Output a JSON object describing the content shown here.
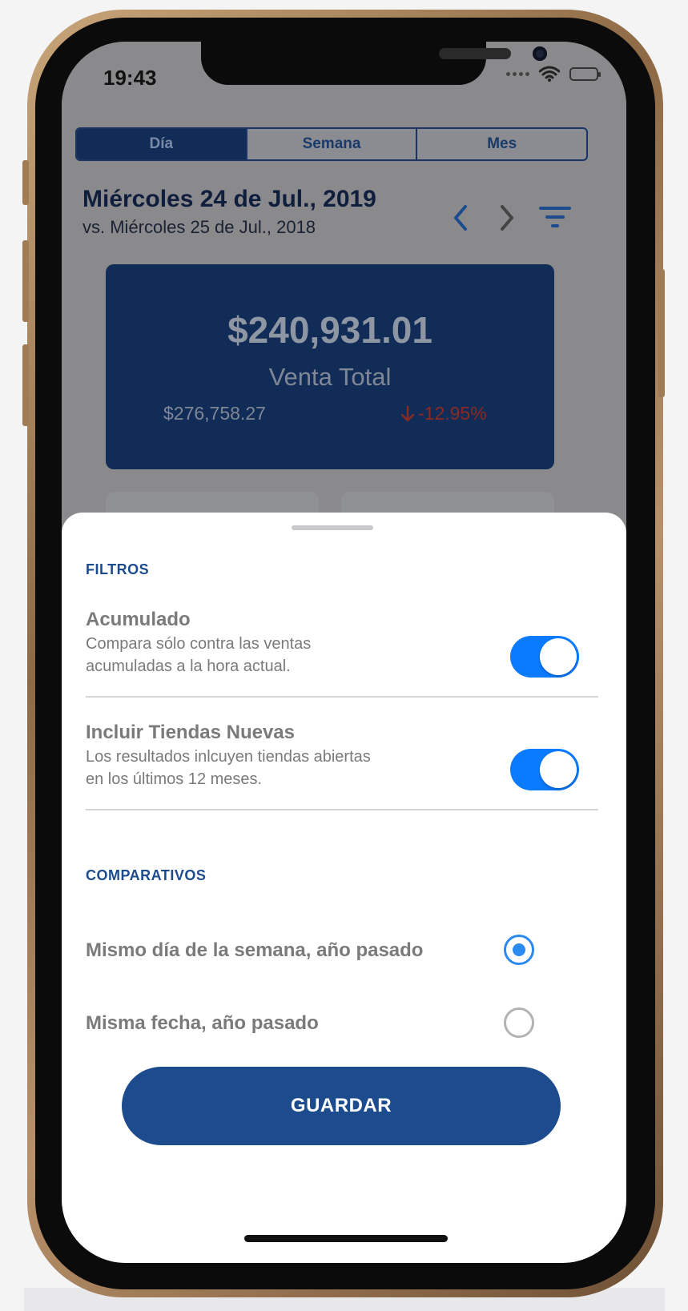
{
  "status_bar": {
    "time": "19:43"
  },
  "segmented": {
    "tabs": [
      "Día",
      "Semana",
      "Mes"
    ],
    "active": "Día"
  },
  "header": {
    "title": "Miércoles 24 de Jul., 2019",
    "subtitle": "vs. Miércoles 25 de Jul., 2018"
  },
  "total_card": {
    "amount": "$240,931.01",
    "label": "Venta Total",
    "previous_amount": "$276,758.27",
    "change": "-12.95%",
    "change_direction": "down",
    "change_color": "#d0352b"
  },
  "sheet": {
    "filters_title": "FILTROS",
    "options": [
      {
        "title": "Acumulado",
        "description_line1": "Compara sólo contra las ventas",
        "description_line2": "acumuladas a la hora actual.",
        "enabled": true
      },
      {
        "title": "Incluir Tiendas Nuevas",
        "description_line1": "Los resultados inlcuyen tiendas abiertas",
        "description_line2": "en los últimos 12 meses.",
        "enabled": true
      }
    ],
    "comparatives_title": "COMPARATIVOS",
    "comparatives": [
      {
        "label": "Mismo día de la semana, año pasado",
        "selected": true
      },
      {
        "label": "Misma fecha, año pasado",
        "selected": false
      }
    ],
    "save_label": "GUARDAR"
  },
  "colors": {
    "accent": "#1d4c8e",
    "toggle_on": "#0a7bff",
    "radio_on": "#2a8af0",
    "card_bg": "#102c57"
  }
}
